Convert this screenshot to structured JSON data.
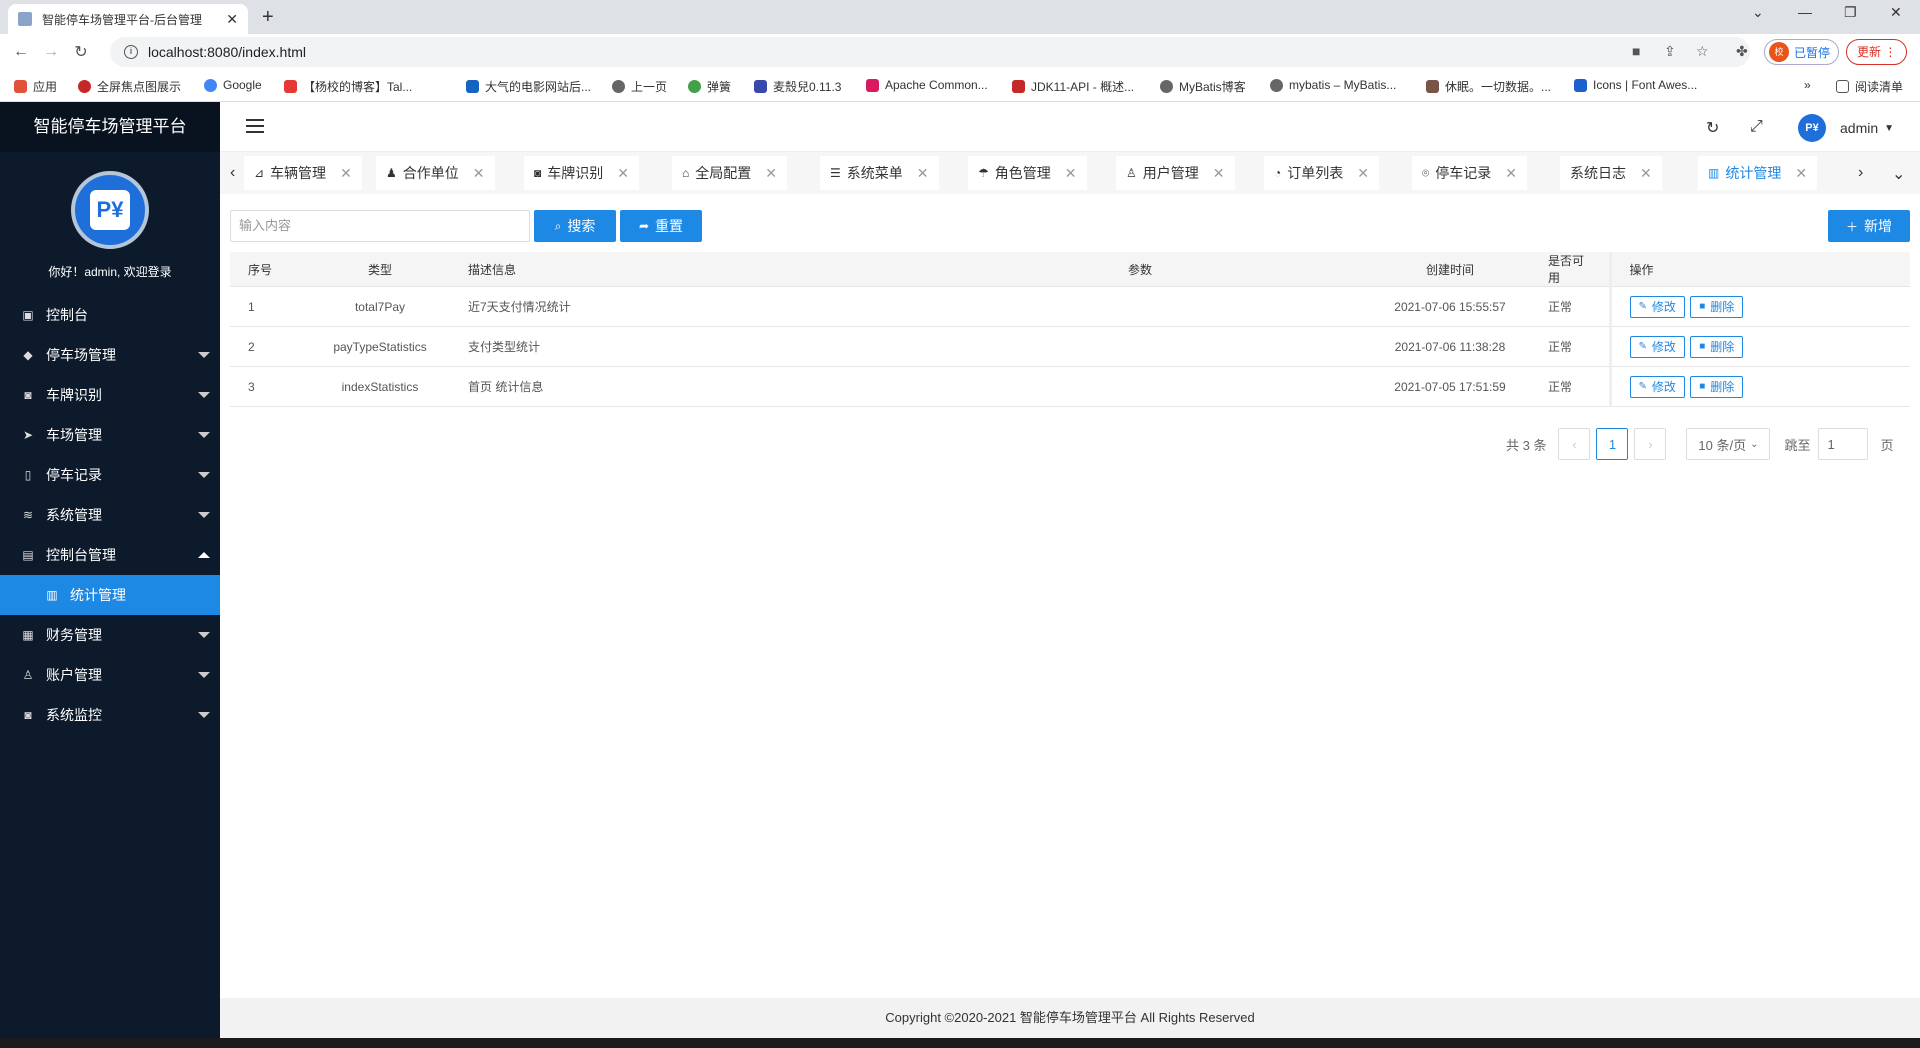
{
  "browser": {
    "tab_title": "智能停车场管理平台-后台管理",
    "url": "localhost:8080/index.html",
    "profile_status": "已暂停",
    "profile_initial": "校",
    "update_label": "更新",
    "bookmarks": [
      "应用",
      "全屏焦点图展示",
      "Google",
      "【杨校的博客】Tal...",
      "大气的电影网站后...",
      "上一页",
      "弹簧",
      "麦殼兒0.11.3",
      "Apache Common...",
      "JDK11-API - 概述...",
      "MyBatis博客",
      "mybatis – MyBatis...",
      "休眠。一切数据。...",
      "Icons | Font Awes..."
    ],
    "reading_list": "阅读清单"
  },
  "sidebar": {
    "title": "智能停车场管理平台",
    "welcome": "你好！admin, 欢迎登录",
    "avatar_text": "P¥",
    "items": [
      {
        "label": "控制台",
        "icon": "monitor-icon"
      },
      {
        "label": "停车场管理",
        "icon": "diamond-icon"
      },
      {
        "label": "车牌识别",
        "icon": "camera-icon"
      },
      {
        "label": "车场管理",
        "icon": "send-icon"
      },
      {
        "label": "停车记录",
        "icon": "note-icon"
      },
      {
        "label": "系统管理",
        "icon": "layers-icon"
      },
      {
        "label": "控制台管理",
        "icon": "clipboard-icon"
      },
      {
        "label": "统计管理",
        "icon": "chart-icon"
      },
      {
        "label": "财务管理",
        "icon": "finance-icon"
      },
      {
        "label": "账户管理",
        "icon": "user-icon"
      },
      {
        "label": "系统监控",
        "icon": "camera-icon"
      }
    ]
  },
  "header": {
    "user": "admin",
    "avatar_text": "P¥"
  },
  "tabs": [
    "车辆管理",
    "合作单位",
    "车牌识别",
    "全局配置",
    "系统菜单",
    "角色管理",
    "用户管理",
    "订单列表",
    "停车记录",
    "系统日志",
    "统计管理"
  ],
  "toolbar": {
    "search_placeholder": "输入内容",
    "search_label": "搜索",
    "reset_label": "重置",
    "add_label": "新增"
  },
  "table": {
    "headers": [
      "序号",
      "类型",
      "描述信息",
      "参数",
      "创建时间",
      "是否可用",
      "操作"
    ],
    "rows": [
      {
        "no": "1",
        "type": "total7Pay",
        "desc": "近7天支付情况统计",
        "param": "",
        "time": "2021-07-06 15:55:57",
        "status": "正常"
      },
      {
        "no": "2",
        "type": "payTypeStatistics",
        "desc": "支付类型统计",
        "param": "",
        "time": "2021-07-06 11:38:28",
        "status": "正常"
      },
      {
        "no": "3",
        "type": "indexStatistics",
        "desc": "首页 统计信息",
        "param": "",
        "time": "2021-07-05 17:51:59",
        "status": "正常"
      }
    ],
    "edit_label": "修改",
    "delete_label": "删除"
  },
  "pager": {
    "total": "共 3 条",
    "current": "1",
    "page_size": "10 条/页",
    "jump_label": "跳至",
    "jump_value": "1",
    "page_suffix": "页"
  },
  "footer": "Copyright ©2020-2021 智能停车场管理平台 All Rights Reserved"
}
